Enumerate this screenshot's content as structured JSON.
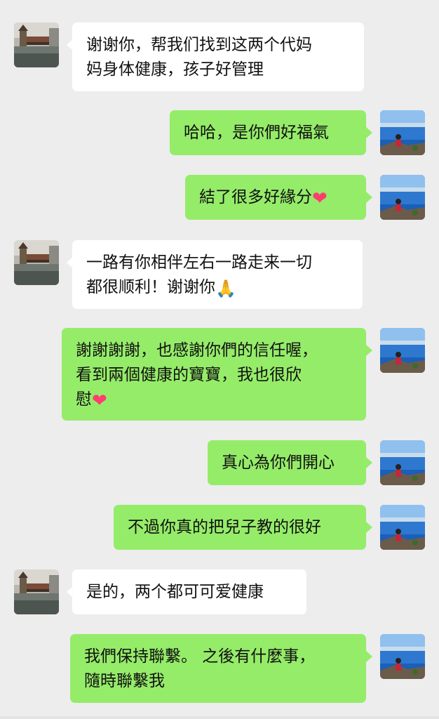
{
  "colors": {
    "background": "#ededed",
    "incoming_bubble": "#ffffff",
    "outgoing_bubble": "#95ec69",
    "heart": "#ff3d6e"
  },
  "avatars": {
    "incoming": "bridge-photo-avatar",
    "outgoing": "lake-photo-avatar"
  },
  "messages": [
    {
      "side": "in",
      "text": "谢谢你，帮我们找到这两个代妈\n妈身体健康，孩子好管理",
      "emoji": ""
    },
    {
      "side": "out",
      "text": "哈哈，是你們好福氣",
      "emoji": ""
    },
    {
      "side": "out",
      "text": "結了很多好緣分",
      "emoji": "heart"
    },
    {
      "side": "in",
      "text": "一路有你相伴左右一路走来一切\n都很顺利！谢谢你",
      "emoji": "pray"
    },
    {
      "side": "out",
      "text": "謝謝謝謝，也感謝你們的信任喔，\n看到兩個健康的寶寶，我也很欣\n慰",
      "emoji": "heart"
    },
    {
      "side": "out",
      "text": "真心為你們開心",
      "emoji": ""
    },
    {
      "side": "out",
      "text": "不過你真的把兒子教的很好",
      "emoji": ""
    },
    {
      "side": "in",
      "text": "是的，两个都可可爱健康",
      "emoji": ""
    },
    {
      "side": "out",
      "text": "我們保持聯繫。 之後有什麼事，\n隨時聯繫我",
      "emoji": ""
    }
  ]
}
